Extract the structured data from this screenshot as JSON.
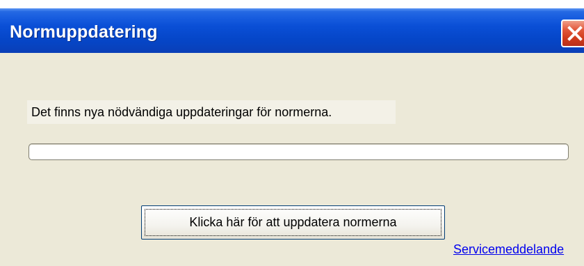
{
  "window": {
    "title": "Normuppdatering",
    "close_icon": "close-icon"
  },
  "content": {
    "message": "Det finns nya nödvändiga uppdateringar för normerna.",
    "progress_value": 0,
    "update_button_label": "Klicka här för att uppdatera normerna",
    "service_link": "Servicemeddelande"
  },
  "colors": {
    "titlebar": "#0a4fd6",
    "client_background": "#ece9d8",
    "close_button": "#e2583a",
    "link": "#0000ee"
  }
}
